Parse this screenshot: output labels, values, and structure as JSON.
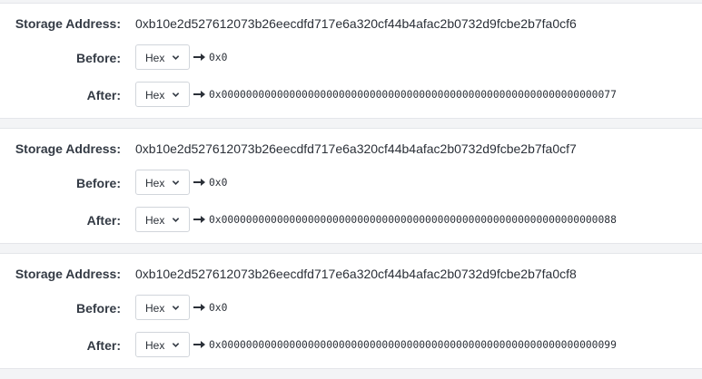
{
  "labels": {
    "storage_address": "Storage Address:",
    "before": "Before:",
    "after": "After:"
  },
  "entries": [
    {
      "address": "0xb10e2d527612073b26eecdfd717e6a320cf44b4afac2b0732d9fcbe2b7fa0cf6",
      "before_format": "Hex",
      "before_value": "0x0",
      "after_format": "Hex",
      "after_value": "0x0000000000000000000000000000000000000000000000000000000000000077"
    },
    {
      "address": "0xb10e2d527612073b26eecdfd717e6a320cf44b4afac2b0732d9fcbe2b7fa0cf7",
      "before_format": "Hex",
      "before_value": "0x0",
      "after_format": "Hex",
      "after_value": "0x0000000000000000000000000000000000000000000000000000000000000088"
    },
    {
      "address": "0xb10e2d527612073b26eecdfd717e6a320cf44b4afac2b0732d9fcbe2b7fa0cf8",
      "before_format": "Hex",
      "before_value": "0x0",
      "after_format": "Hex",
      "after_value": "0x0000000000000000000000000000000000000000000000000000000000000099"
    }
  ],
  "icons": {
    "arrow": "arrow-right-icon",
    "dropdown": "chevron-down-icon"
  },
  "colors": {
    "background": "#f3f4f6",
    "panel": "#ffffff",
    "text": "#2b3038",
    "label": "#333a44",
    "border": "#d1d5db"
  }
}
